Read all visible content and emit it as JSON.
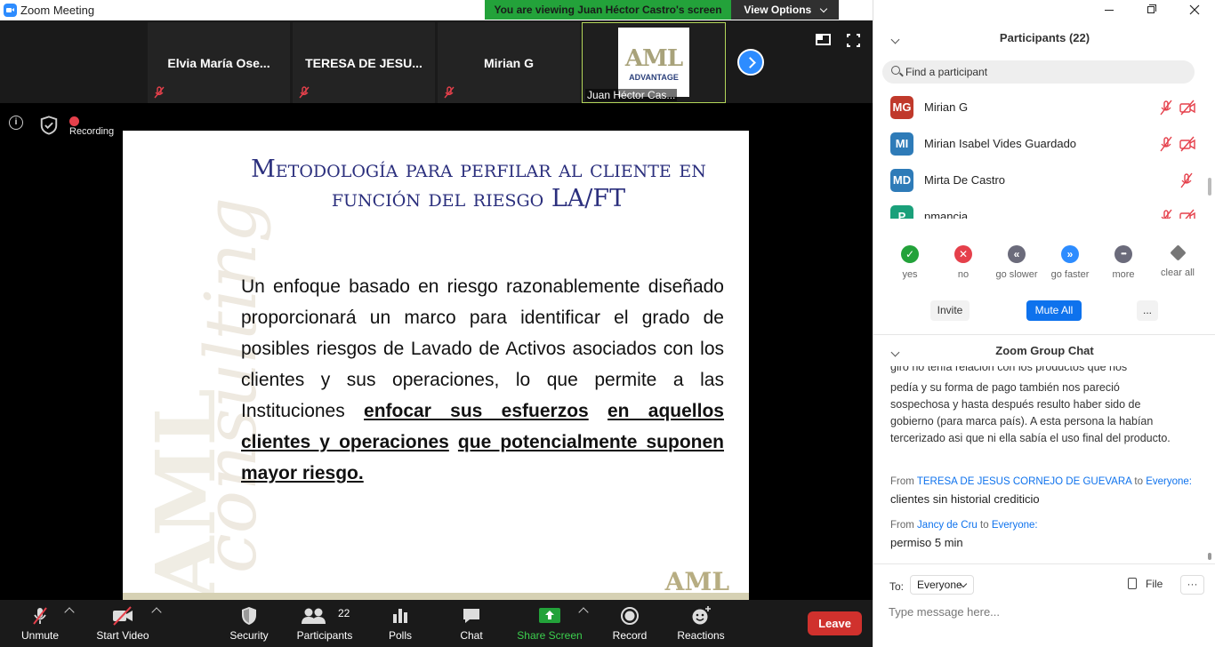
{
  "window": {
    "title": "Zoom Meeting",
    "banner": "You are viewing Juan Héctor Castro's screen",
    "view_options": "View Options"
  },
  "thumbnails": [
    {
      "name": "Elvia   María Ose..."
    },
    {
      "name": "TERESA  DE  JESU..."
    },
    {
      "name": "Mirian G"
    },
    {
      "name": "Juan Héctor Cas...",
      "logo_top": "AML",
      "logo_bottom": "ADVANTAGE"
    }
  ],
  "status": {
    "recording": "Recording"
  },
  "slide": {
    "title": "Metodología para perfilar al cliente en función del riesgo LA/FT",
    "body_plain": "Un enfoque basado en riesgo razonablemente diseñado proporcionará un marco para identificar el grado de posibles riesgos de Lavado de Activos asociados con los clientes y sus operaciones, lo que permite a las Instituciones ",
    "body_u1": "enfocar sus esfuerzos",
    "body_sp1": " ",
    "body_u2": "en aquellos clientes y operaciones",
    "body_sp2": " ",
    "body_u3": "que potencialmente suponen mayor riesgo.",
    "logo": "AML",
    "bg_word": "consulting",
    "bg_aml": "AML"
  },
  "toolbar": {
    "unmute": "Unmute",
    "start_video": "Start Video",
    "security": "Security",
    "participants": "Participants",
    "participants_count": "22",
    "polls": "Polls",
    "chat": "Chat",
    "share_screen": "Share Screen",
    "record": "Record",
    "reactions": "Reactions",
    "leave": "Leave"
  },
  "participants_panel": {
    "header": "Participants (22)",
    "search_placeholder": "Find a participant",
    "list": [
      {
        "initials": "MG",
        "name": "Mirian G",
        "color": "#c0392b"
      },
      {
        "initials": "MI",
        "name": "Mirian Isabel Vides Guardado",
        "color": "#2e7bb8"
      },
      {
        "initials": "MD",
        "name": "Mirta De Castro",
        "color": "#2e7bb8"
      },
      {
        "initials": "P",
        "name": "pmancia",
        "color": "#1aa07a"
      }
    ],
    "reactions": [
      {
        "label": "yes",
        "glyph": "✓",
        "color": "#23a23a"
      },
      {
        "label": "no",
        "glyph": "✕",
        "color": "#e5404b"
      },
      {
        "label": "go slower",
        "glyph": "«",
        "color": "#6b6b7b"
      },
      {
        "label": "go faster",
        "glyph": "»",
        "color": "#2d8cff"
      },
      {
        "label": "more",
        "glyph": "•••",
        "color": "#6b6b7b"
      },
      {
        "label": "clear all",
        "glyph": "",
        "color": "#777777"
      }
    ],
    "invite": "Invite",
    "mute_all": "Mute All",
    "more": "..."
  },
  "chat_panel": {
    "header": "Zoom Group Chat",
    "partial_top": "giro no tenía relación con los productos que nos",
    "message_prev": "pedía y su forma de pago también nos pareció sospechosa y hasta después resulto haber sido de gobierno (para marca país). A esta persona la habían tercerizado asi que ni ella sabía el uso final del producto.",
    "messages": [
      {
        "from_prefix": "From",
        "from": "TERESA DE JESUS CORNEJO DE GUEVARA",
        "to_word": "to",
        "to": "Everyone:",
        "text": "clientes sin historial crediticio"
      },
      {
        "from_prefix": "From",
        "from": "Jancy de Cru",
        "to_word": "to",
        "to": "Everyone:",
        "text": "permiso 5 min"
      }
    ],
    "to_label": "To:",
    "to_value": "Everyone",
    "file": "File",
    "more": "···",
    "input_placeholder": "Type message here..."
  }
}
